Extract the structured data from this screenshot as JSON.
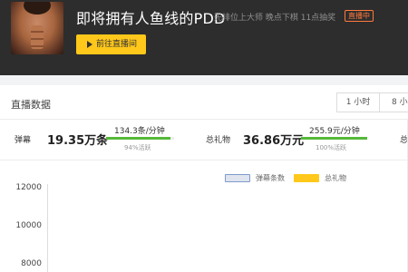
{
  "header": {
    "title": "即将拥有人鱼线的PDD",
    "subtitle": "先排位上大师  晚点下棋 11点抽奖",
    "live_badge": "直播中",
    "goto_button": "前往直播间"
  },
  "section": {
    "title": "直播数据",
    "range_tabs": [
      "1 小时",
      "8 小"
    ]
  },
  "stats": {
    "danmu": {
      "label": "弹幕",
      "value": "19.35万条",
      "rate": "134.3条/分钟",
      "activity": "94%活跃",
      "activity_fraction": 0.94
    },
    "gift": {
      "label": "总礼物",
      "value": "36.86万元",
      "rate": "255.9元/分钟",
      "activity": "100%活跃",
      "activity_fraction": 1.0
    },
    "third_label": "总"
  },
  "chart_data": {
    "type": "line",
    "series": [
      {
        "name": "弹幕条数",
        "color": "#dfe4ee",
        "values": []
      },
      {
        "name": "总礼物",
        "color": "#ffc81a",
        "values": []
      }
    ],
    "y_ticks": [
      "12000",
      "10000",
      "8000"
    ],
    "ylim": [
      8000,
      12000
    ],
    "legend": "top-right",
    "grid": false
  }
}
